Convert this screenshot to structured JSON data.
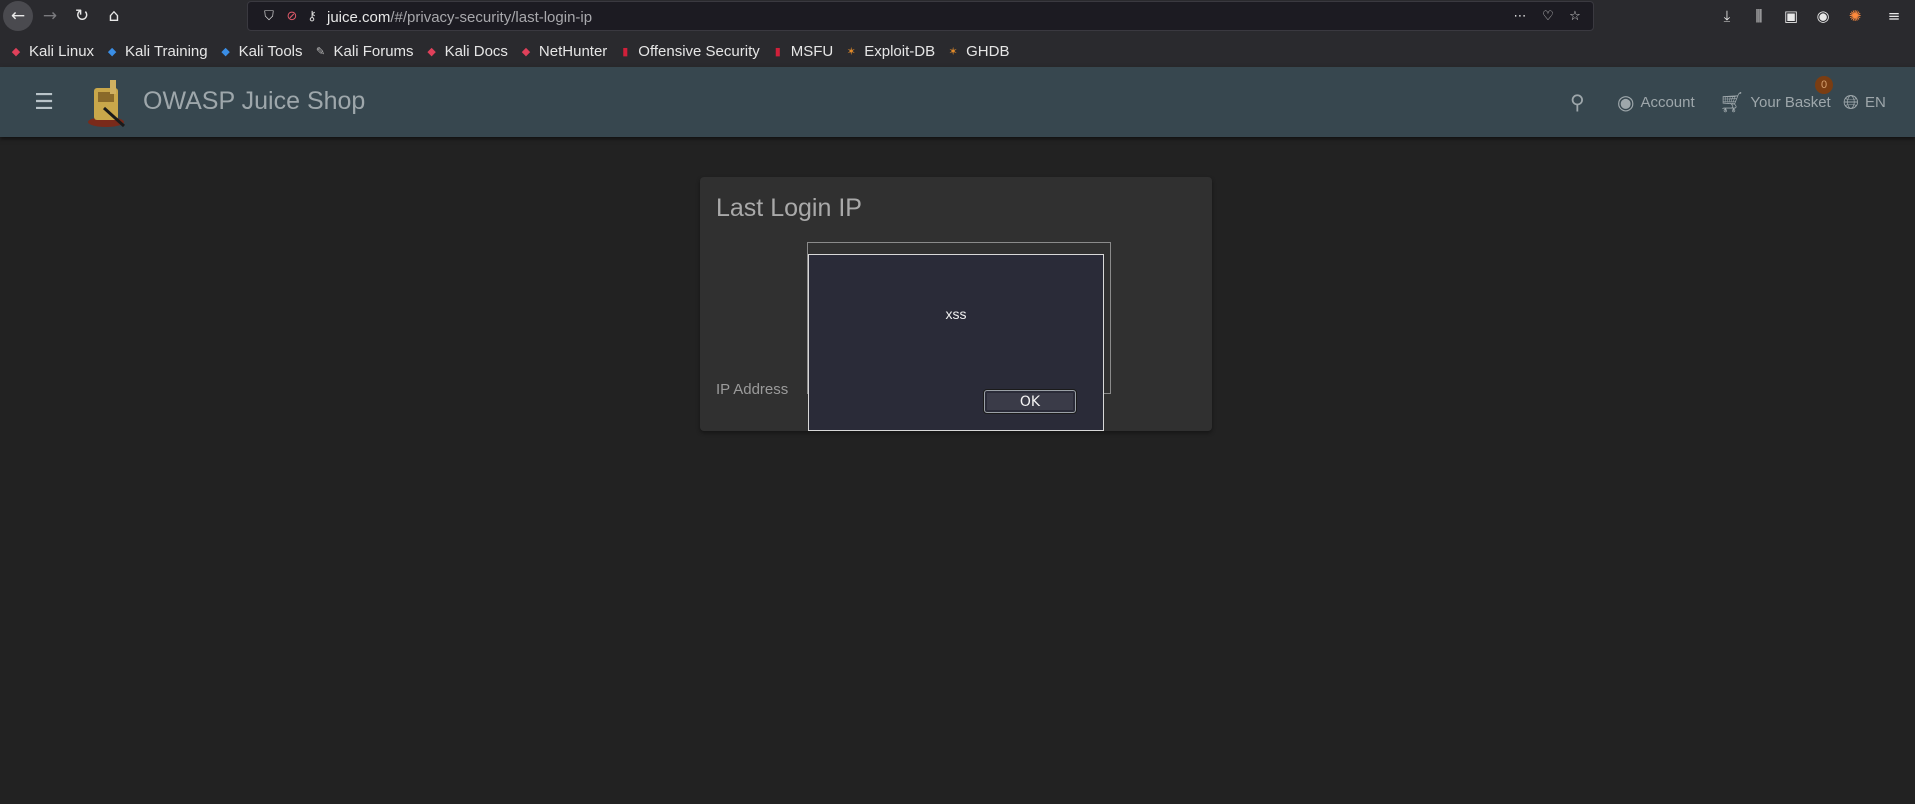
{
  "browser": {
    "url_host": "juice.com",
    "url_path": "/#/privacy-security/last-login-ip",
    "icons": [
      "back-icon",
      "forward-icon",
      "reload-icon",
      "home-icon",
      "shield-icon",
      "permissions-icon",
      "key-icon",
      "more-icon",
      "pocket-icon",
      "star-icon",
      "download-icon",
      "library-icon",
      "sidebar-icon",
      "account-icon",
      "firefox-icon",
      "hamburger-icon"
    ]
  },
  "bookmarks": [
    {
      "label": "Kali Linux",
      "icon": "kali-icon"
    },
    {
      "label": "Kali Training",
      "icon": "kali-training-icon"
    },
    {
      "label": "Kali Tools",
      "icon": "kali-tools-icon"
    },
    {
      "label": "Kali Forums",
      "icon": "kali-forums-icon"
    },
    {
      "label": "Kali Docs",
      "icon": "kali-docs-icon"
    },
    {
      "label": "NetHunter",
      "icon": "nethunter-icon"
    },
    {
      "label": "Offensive Security",
      "icon": "offsec-icon"
    },
    {
      "label": "MSFU",
      "icon": "msfu-icon"
    },
    {
      "label": "Exploit-DB",
      "icon": "exploitdb-icon"
    },
    {
      "label": "GHDB",
      "icon": "ghdb-icon"
    }
  ],
  "app": {
    "title": "OWASP Juice Shop",
    "account_label": "Account",
    "basket_label": "Your Basket",
    "basket_count": "0",
    "language_label": "EN"
  },
  "card": {
    "title": "Last Login IP",
    "ip_label": "IP Address"
  },
  "dialog": {
    "message": "xss",
    "ok_label": "OK"
  },
  "colors": {
    "page_bg": "#222222",
    "header_bg": "#37474f",
    "card_bg": "#303030",
    "dialog_bg": "#2a2b38"
  }
}
